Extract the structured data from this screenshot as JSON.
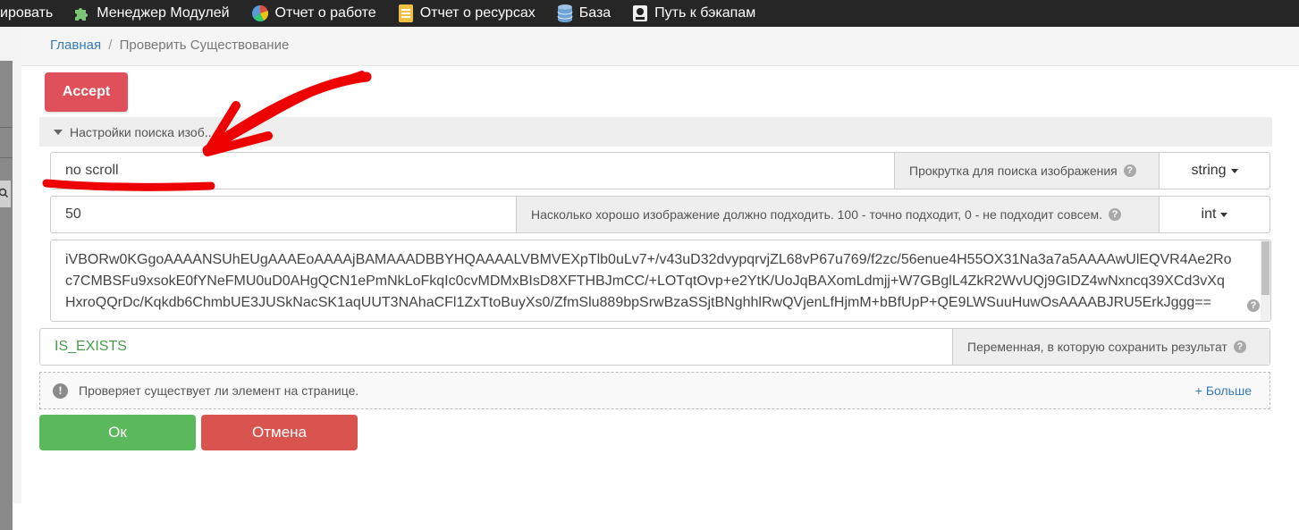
{
  "topbar": {
    "items": [
      {
        "label": "ировать",
        "icon": "none"
      },
      {
        "label": "Менеджер Модулей",
        "icon": "puzzle-icon"
      },
      {
        "label": "Отчет о работе",
        "icon": "pie-chart-icon"
      },
      {
        "label": "Отчет о ресурсах",
        "icon": "document-icon"
      },
      {
        "label": "База",
        "icon": "database-icon"
      },
      {
        "label": "Путь к бэкапам",
        "icon": "backup-icon"
      }
    ]
  },
  "breadcrumb": {
    "home": "Главная",
    "separator": "/",
    "current": "Проверить Существование"
  },
  "accept_label": "Accept",
  "section_title": "Настройки поиска изоб... ия",
  "fields": {
    "scroll": {
      "value": "no scroll",
      "description": "Прокрутка для поиска изображения",
      "type": "string"
    },
    "match": {
      "value": "50",
      "description": "Насколько хорошо изображение должно подходить. 100 - точно подходит, 0 - не подходит совсем.",
      "type": "int"
    },
    "image_data": "iVBORw0KGgoAAAANSUhEUgAAAEoAAAAjBAMAAADBBYHQAAAALVBMVEXpTlb0uLv7+/v43uD32dvypqrvjZL68vP67u769/f2zc/56enue4H55OX31Na3a7a5AAAAwUlEQVR4Ae2Roc7CMBSFu9xsokE0fYNeFMU0uD0AHgQCN1ePmNkLoFkqIc0cvMDMxBIsD8XFTHBJmCC/+LOTqtOvp+e2YtK/UoJqBAXomLdmjj+W7GBglL4ZkR2WvUQj9GIDZ4wNxncq39XCd3vXqHxroQQrDc/Kqkdb6ChmbUE3JUSkNacSK1aqUUT3NAhaCFl1ZxTtoBuyXs0/ZfmSlu889bpSrwBzaSSjtBNghhlRwQVjenLfHjmM+bBfUpP+QE9LWSuuHuwOsAAAABJRU5ErkJggg==",
    "variable": {
      "value": "IS_EXISTS",
      "description": "Переменная, в которую сохранить результат"
    }
  },
  "info": {
    "text": "Проверяет существует ли элемент на странице.",
    "more": "+ Больше"
  },
  "buttons": {
    "ok": "Ок",
    "cancel": "Отмена"
  },
  "colors": {
    "accept": "#e0505a",
    "ok": "#5cb85c",
    "cancel": "#d9534f",
    "annotation": "#ee0000",
    "link": "#337ab7"
  }
}
